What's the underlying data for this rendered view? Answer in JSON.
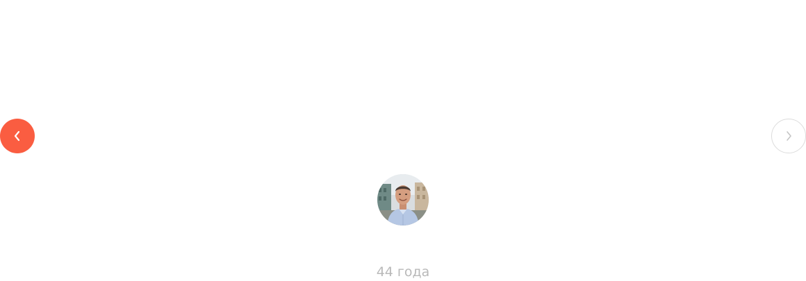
{
  "carousel": {
    "prev_icon": "chevron-left-icon",
    "next_icon": "chevron-right-icon",
    "accent_color": "#fa5d41",
    "inactive_border_color": "#dcdcdc"
  },
  "profile": {
    "avatar_icon": "person-photo",
    "age_text": "44 года"
  }
}
